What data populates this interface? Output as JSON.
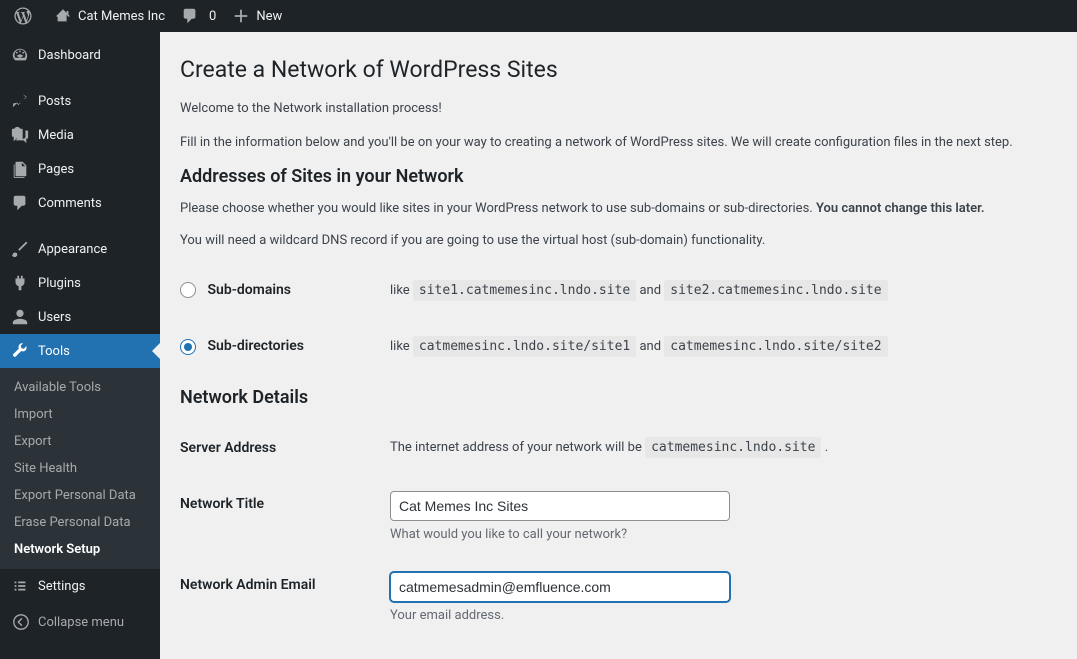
{
  "toolbar": {
    "site_name": "Cat Memes Inc",
    "comment_count": "0",
    "new_label": "New"
  },
  "menu": {
    "dashboard": "Dashboard",
    "posts": "Posts",
    "media": "Media",
    "pages": "Pages",
    "comments": "Comments",
    "appearance": "Appearance",
    "plugins": "Plugins",
    "users": "Users",
    "tools": "Tools",
    "settings": "Settings",
    "collapse": "Collapse menu",
    "tools_submenu": {
      "available_tools": "Available Tools",
      "import": "Import",
      "export": "Export",
      "site_health": "Site Health",
      "export_personal": "Export Personal Data",
      "erase_personal": "Erase Personal Data",
      "network_setup": "Network Setup"
    }
  },
  "page": {
    "title": "Create a Network of WordPress Sites",
    "welcome": "Welcome to the Network installation process!",
    "intro": "Fill in the information below and you'll be on your way to creating a network of WordPress sites. We will create configuration files in the next step.",
    "addresses_heading": "Addresses of Sites in your Network",
    "choose_text": "Please choose whether you would like sites in your WordPress network to use sub-domains or sub-directories. ",
    "cannot_change": "You cannot change this later.",
    "wildcard_text": "You will need a wildcard DNS record if you are going to use the virtual host (sub-domain) functionality.",
    "subdomains_label": "Sub-domains",
    "subdomains_example": {
      "prefix": "like ",
      "code1": "site1.catmemesinc.lndo.site",
      "mid": " and ",
      "code2": "site2.catmemesinc.lndo.site"
    },
    "subdirs_label": "Sub-directories",
    "subdirs_example": {
      "prefix": "like ",
      "code1": "catmemesinc.lndo.site/site1",
      "mid": " and ",
      "code2": "catmemesinc.lndo.site/site2"
    },
    "selected_address_type": "subdirs",
    "network_details_heading": "Network Details",
    "server_address_label": "Server Address",
    "server_address_text": "The internet address of your network will be ",
    "server_address_code": "catmemesinc.lndo.site",
    "server_address_suffix": " .",
    "network_title_label": "Network Title",
    "network_title_value": "Cat Memes Inc Sites",
    "network_title_desc": "What would you like to call your network?",
    "admin_email_label": "Network Admin Email",
    "admin_email_value": "catmemesadmin@emfluence.com",
    "admin_email_desc": "Your email address."
  }
}
